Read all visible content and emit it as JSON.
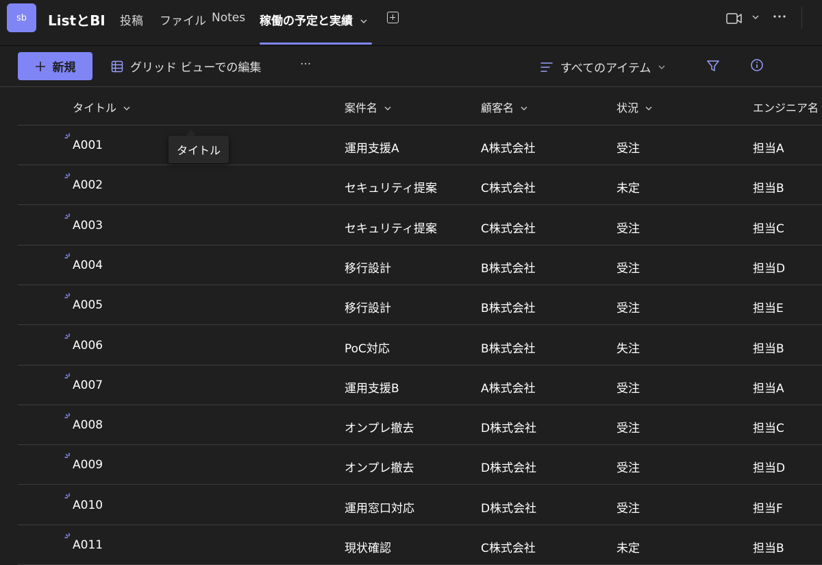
{
  "header": {
    "avatar_initials": "sb",
    "team_name": "ListとBI",
    "tabs": [
      {
        "label": "投稿"
      },
      {
        "label": "ファイル"
      },
      {
        "label": "Notes"
      },
      {
        "label": "稼働の予定と実績"
      }
    ],
    "icons": [
      "add-tab-icon",
      "video-call-icon",
      "chevron-down-icon",
      "more-options-icon"
    ]
  },
  "toolbar": {
    "new_label": "新規",
    "grid_edit_label": "グリッド ビューでの編集",
    "more_label": "···",
    "view_label": "すべてのアイテム",
    "icons": [
      "plus-icon",
      "grid-icon",
      "view-lines-icon",
      "filter-icon",
      "info-icon"
    ]
  },
  "table": {
    "columns": [
      "タイトル",
      "案件名",
      "顧客名",
      "状況",
      "エンジニア名"
    ],
    "rows": [
      [
        "A001",
        "運用支援A",
        "A株式会社",
        "受注",
        "担当A"
      ],
      [
        "A002",
        "セキュリティ提案",
        "C株式会社",
        "未定",
        "担当B"
      ],
      [
        "A003",
        "セキュリティ提案",
        "C株式会社",
        "受注",
        "担当C"
      ],
      [
        "A004",
        "移行設計",
        "B株式会社",
        "受注",
        "担当D"
      ],
      [
        "A005",
        "移行設計",
        "B株式会社",
        "受注",
        "担当E"
      ],
      [
        "A006",
        "PoC対応",
        "B株式会社",
        "失注",
        "担当B"
      ],
      [
        "A007",
        "運用支援B",
        "A株式会社",
        "受注",
        "担当A"
      ],
      [
        "A008",
        "オンプレ撤去",
        "D株式会社",
        "受注",
        "担当C"
      ],
      [
        "A009",
        "オンプレ撤去",
        "D株式会社",
        "受注",
        "担当D"
      ],
      [
        "A010",
        "運用窓口対応",
        "D株式会社",
        "受注",
        "担当F"
      ],
      [
        "A011",
        "現状確認",
        "C株式会社",
        "未定",
        "担当B"
      ]
    ]
  },
  "tooltip": {
    "text": "タイトル"
  },
  "colors": {
    "accent": "#7f85f5",
    "background": "#1f1f1f",
    "divider": "#3d3d3d"
  }
}
